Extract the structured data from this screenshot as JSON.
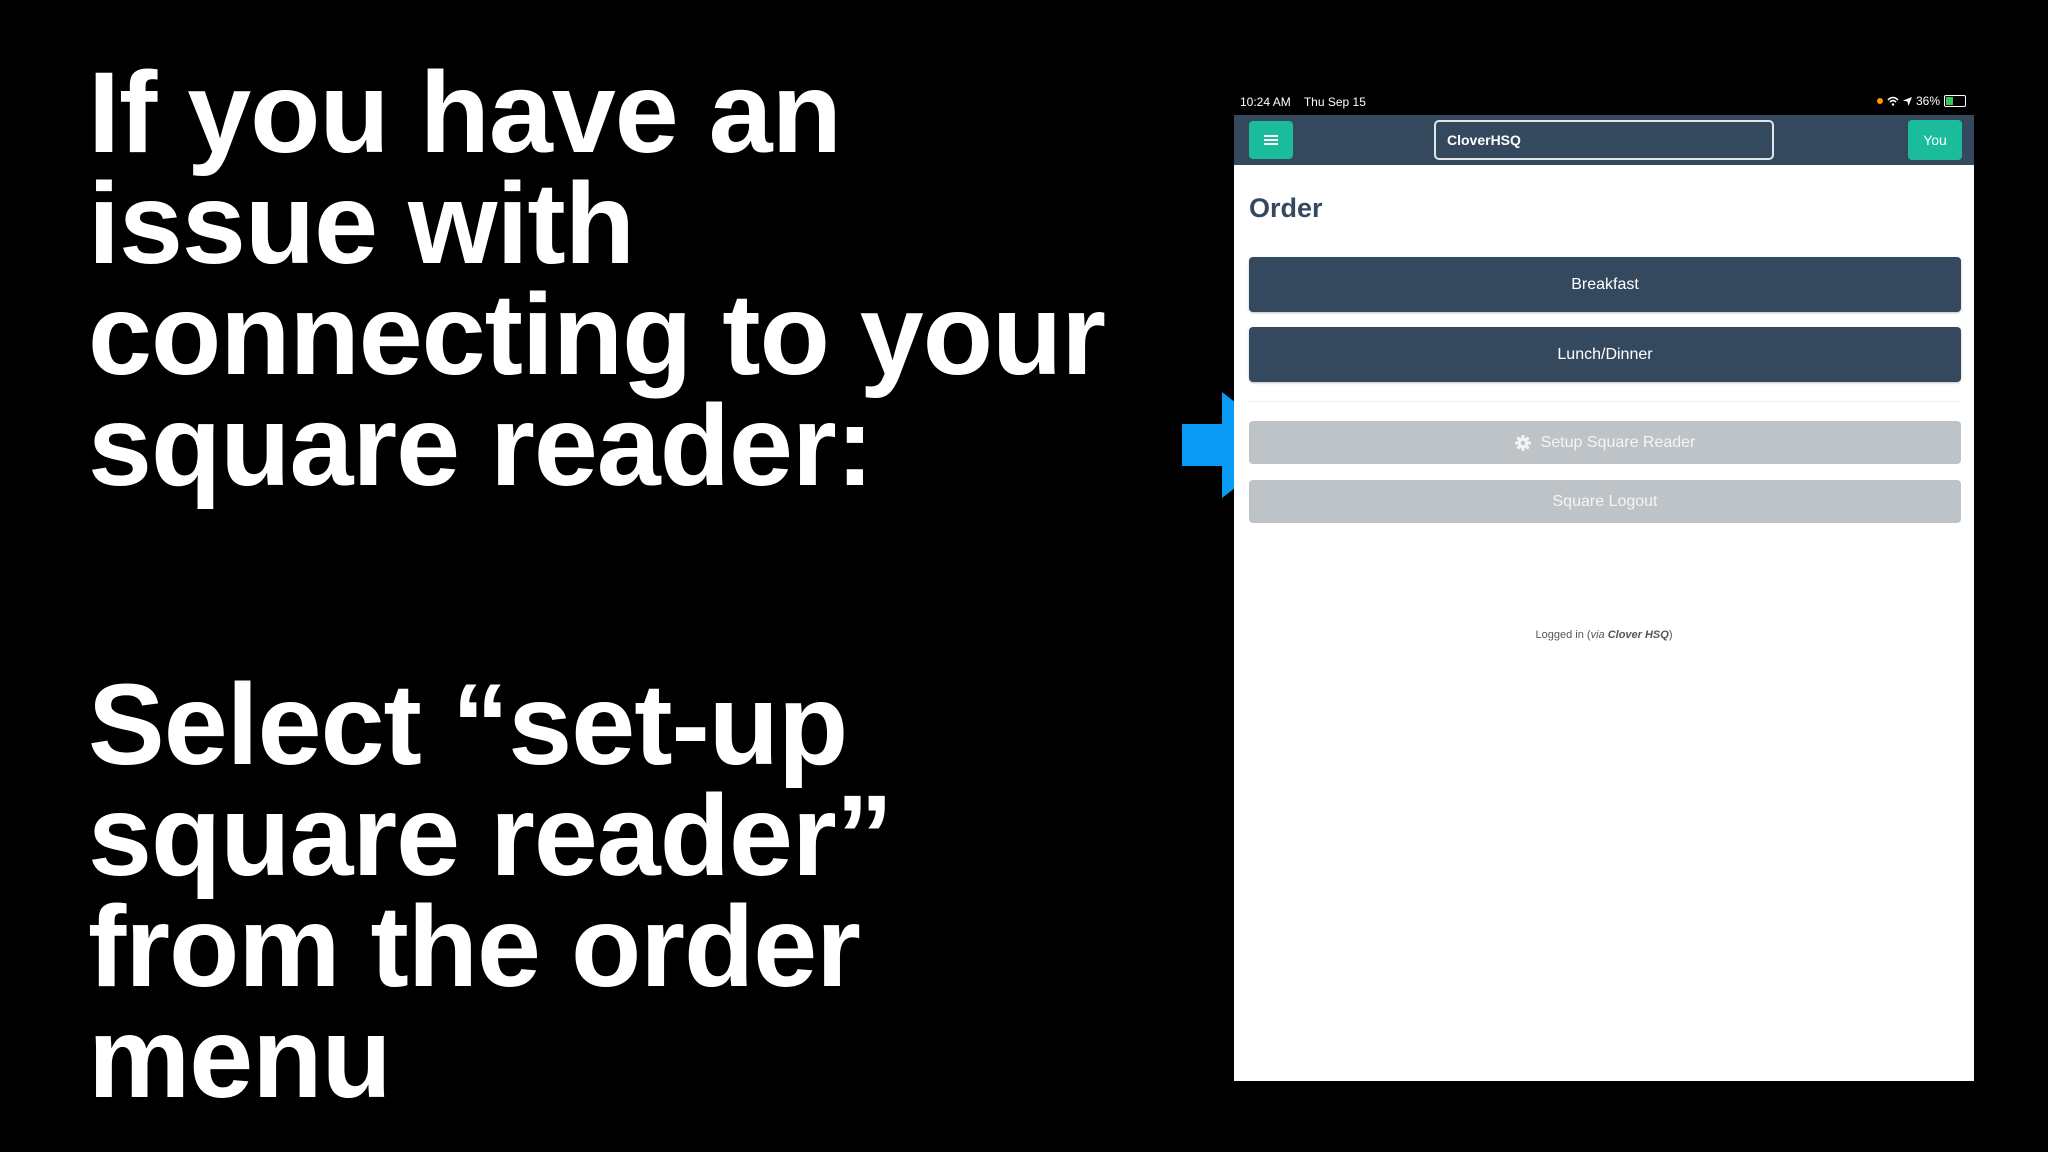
{
  "slide": {
    "block1": [
      "If you have an",
      "issue with",
      "connecting to your",
      "square reader:"
    ],
    "block2": [
      "Select “set-up",
      "square reader”",
      "from the order",
      "menu"
    ]
  },
  "status_bar": {
    "time": "10:24 AM",
    "date": "Thu Sep 15",
    "battery": "36%"
  },
  "navbar": {
    "search_value": "CloverHSQ",
    "user_label": "You"
  },
  "page": {
    "title": "Order",
    "buttons": [
      "Breakfast",
      "Lunch/Dinner"
    ],
    "setup_label": "Setup Square Reader",
    "logout_label": "Square Logout",
    "logged_in": {
      "prefix": "Logged in",
      "via": "via",
      "provider": "Clover HSQ"
    }
  },
  "icons": {
    "menu": "hamburger-icon",
    "setup": "gear-icon",
    "pointer": "arrow-right-icon"
  },
  "colors": {
    "navbar": "#34495e",
    "accent": "#1abc9c",
    "grey_button": "#bdc3c7",
    "arrow": "#0a9cf5"
  }
}
